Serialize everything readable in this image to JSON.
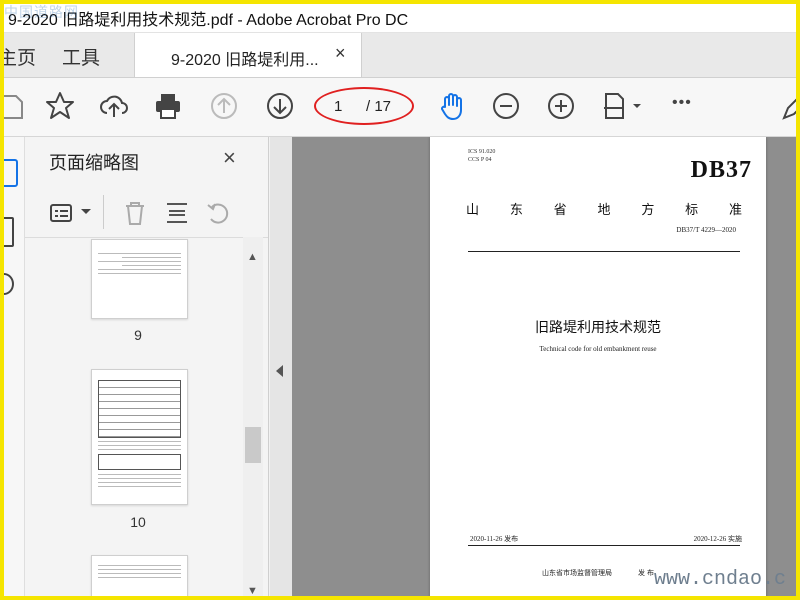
{
  "window": {
    "title": "9-2020 旧路堤利用技术规范.pdf - Adobe Acrobat Pro DC",
    "watermark_top": "中国道路网"
  },
  "tabs": {
    "home": "主页",
    "tools": "工具",
    "doc": "9-2020 旧路堤利用...",
    "close": "×"
  },
  "toolbar": {
    "page_current": "1",
    "page_total": "/ 17",
    "more": "•••"
  },
  "thumbnails": {
    "panel_title": "页面缩略图",
    "close": "×",
    "pages": [
      {
        "num": "9"
      },
      {
        "num": "10"
      },
      {
        "num": ""
      }
    ]
  },
  "document": {
    "ics": "ICS  91.020",
    "ccs": "CCS  P  04",
    "db": "DB37",
    "province_std": [
      "山",
      "东",
      "省",
      "地",
      "方",
      "标",
      "准"
    ],
    "std_code": "DB37/T  4229—2020",
    "title": "旧路堤利用技术规范",
    "english_title": "Technical code for old embankment reuse",
    "issue_date": "2020-11-26 发布",
    "impl_date": "2020-12-26 实施",
    "issuer": "山东省市场监督管理局",
    "publish": "发  布"
  },
  "watermark_bottom": "www.cndao.c",
  "colors": {
    "accent_blue": "#1473e6",
    "annotation_red": "#e02020",
    "frame_yellow": "#f5e500"
  }
}
